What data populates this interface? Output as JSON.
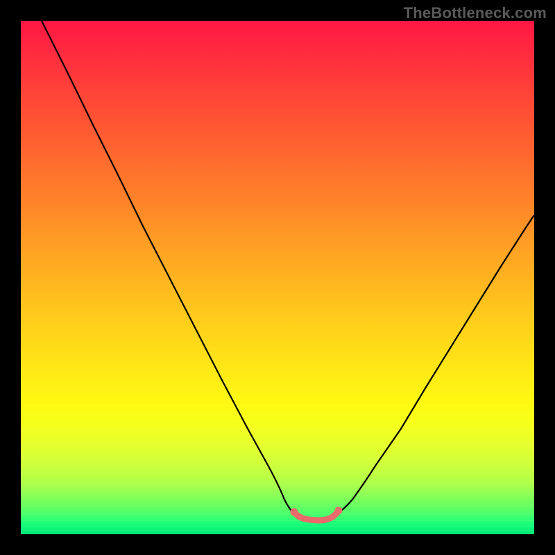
{
  "watermark": "TheBottleneck.com",
  "colors": {
    "frame": "#000000",
    "curve": "#000000",
    "highlight": "#e86a6a",
    "gradient_top": "#ff1744",
    "gradient_mid": "#ffd21a",
    "gradient_bottom": "#00e676"
  },
  "chart_data": {
    "type": "line",
    "title": "",
    "xlabel": "",
    "ylabel": "",
    "x": [
      0.0,
      0.05,
      0.1,
      0.15,
      0.2,
      0.25,
      0.3,
      0.35,
      0.4,
      0.45,
      0.5,
      0.52,
      0.54,
      0.56,
      0.58,
      0.6,
      0.62,
      0.65,
      0.7,
      0.75,
      0.8,
      0.85,
      0.9,
      0.95,
      1.0
    ],
    "values": [
      1.0,
      0.9,
      0.8,
      0.7,
      0.6,
      0.5,
      0.4,
      0.3,
      0.21,
      0.13,
      0.06,
      0.045,
      0.035,
      0.03,
      0.03,
      0.032,
      0.04,
      0.06,
      0.11,
      0.18,
      0.26,
      0.35,
      0.44,
      0.53,
      0.62
    ],
    "highlight_range_x": [
      0.5,
      0.62
    ],
    "xlim": [
      0,
      1
    ],
    "ylim": [
      0,
      1
    ]
  }
}
